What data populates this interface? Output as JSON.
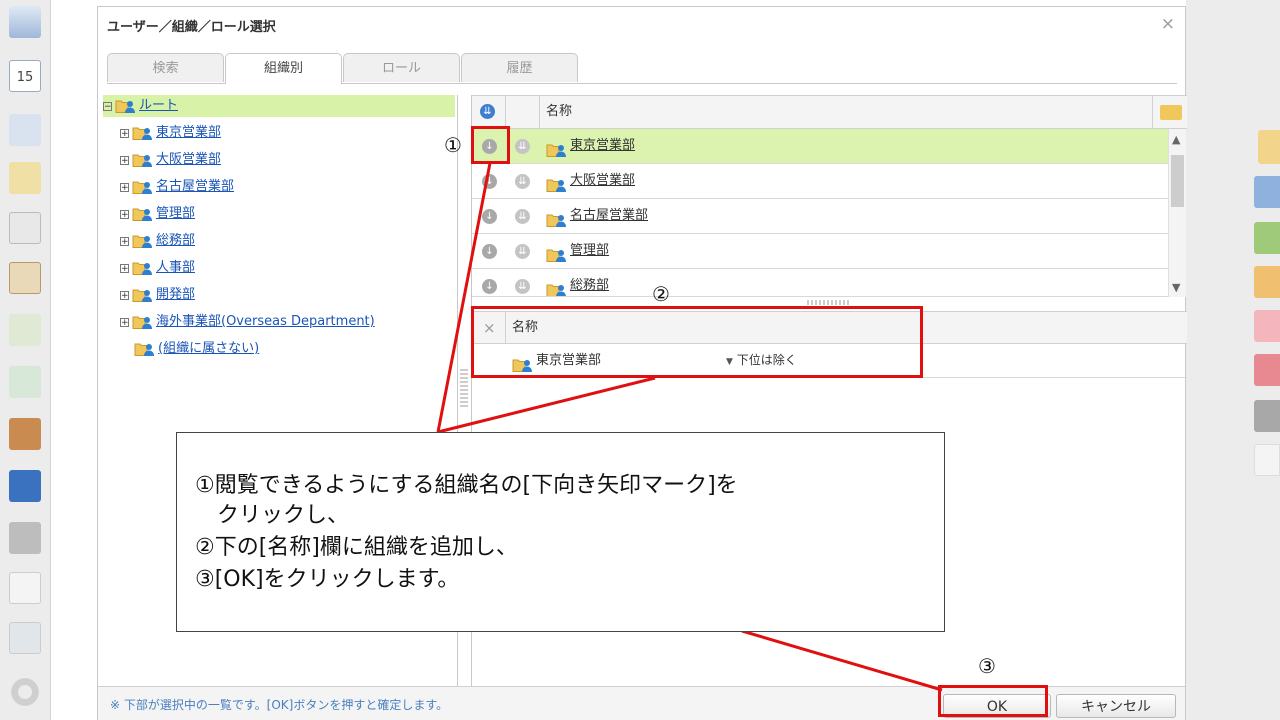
{
  "dialog": {
    "title": "ユーザー／組織／ロール選択",
    "close_glyph": "×"
  },
  "tabs": [
    {
      "label": "検索",
      "active": false
    },
    {
      "label": "組織別",
      "active": true
    },
    {
      "label": "ロール",
      "active": false
    },
    {
      "label": "履歴",
      "active": false
    }
  ],
  "tree": {
    "root": "ルート",
    "expand_glyph": "⊟",
    "collapse_glyph": "⊞",
    "children": [
      "東京営業部",
      "大阪営業部",
      "名古屋営業部",
      "管理部",
      "総務部",
      "人事部",
      "開発部",
      "海外事業部(Overseas Department)"
    ],
    "unassigned": "(組織に属さない)"
  },
  "org_grid": {
    "column_name": "名称",
    "selected_row": 0,
    "rows": [
      "東京営業部",
      "大阪営業部",
      "名古屋営業部",
      "管理部",
      "総務部"
    ]
  },
  "selected_grid": {
    "column_name": "名称",
    "rows": [
      {
        "name": "東京営業部",
        "scope": "下位は除く"
      }
    ]
  },
  "footer": {
    "note": "※ 下部が選択中の一覧です。[OK]ボタンを押すと確定します。",
    "ok_label": "OK",
    "cancel_label": "キャンセル"
  },
  "annotations": {
    "markers": [
      "①",
      "②",
      "③"
    ],
    "lines": [
      "①閲覧できるようにする組織名の[下向き矢印マーク]を",
      "　クリックし、",
      "②下の[名称]欄に組織を追加し、",
      "③[OK]をクリックします。"
    ]
  },
  "colors": {
    "accent_green": "#d8f3a8",
    "link_blue": "#1a55b8",
    "annotation_red": "#e01010"
  },
  "icons": {
    "org_folder": "org-folder-icon",
    "add_down": "arrow-down-circle-icon",
    "add_down_all": "double-arrow-down-circle-icon"
  }
}
